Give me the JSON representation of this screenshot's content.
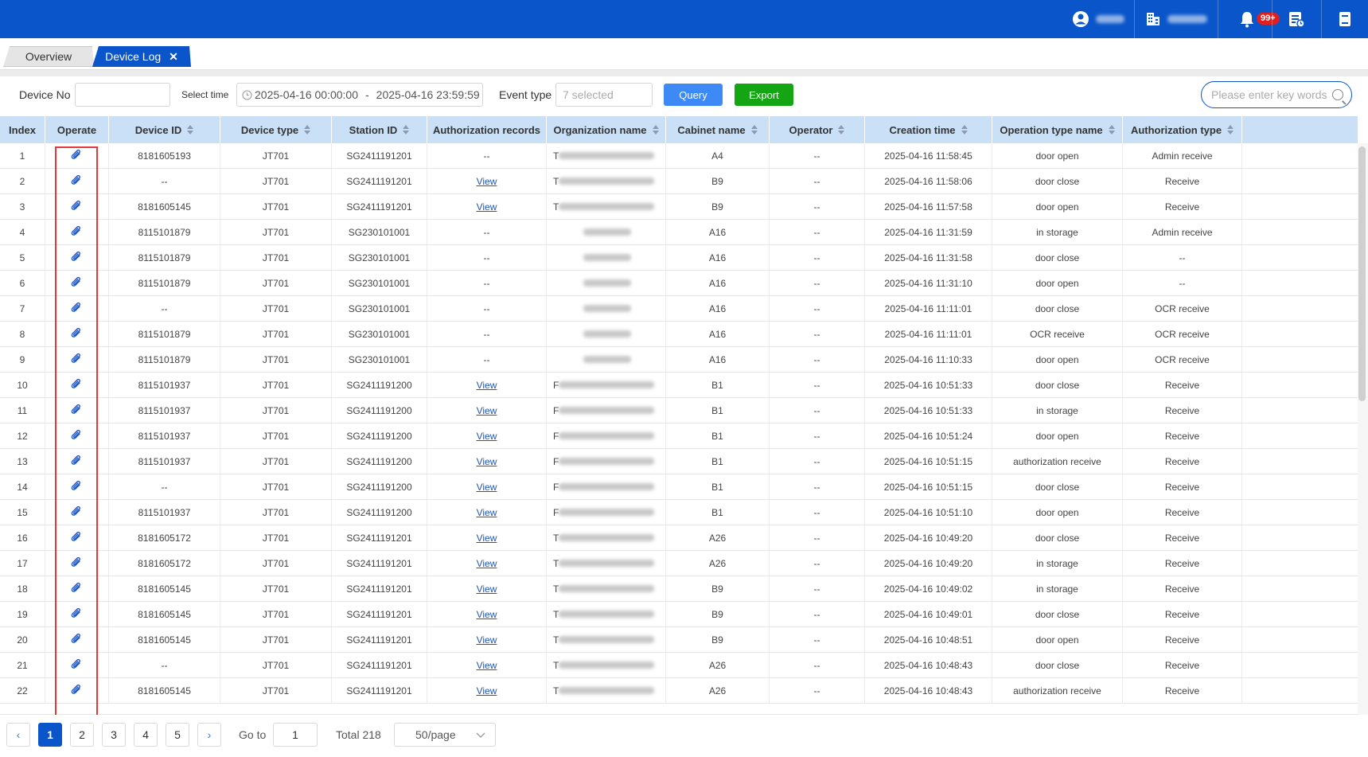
{
  "header": {
    "user_icon": "user-circle-icon",
    "org_icon": "building-icon",
    "notification_icon": "bell-icon",
    "notification_badge": "99+",
    "task_icon": "task-list-icon",
    "book_icon": "book-icon"
  },
  "tabs": [
    {
      "label": "Overview"
    },
    {
      "label": "Device Log",
      "close": "✕"
    }
  ],
  "filters": {
    "device_no_label": "Device No",
    "device_no_value": "",
    "select_time_label": "Select time",
    "time_start": "2025-04-16 00:00:00",
    "time_sep": "-",
    "time_end": "2025-04-16 23:59:59",
    "event_type_label": "Event type",
    "event_type_placeholder": "7 selected",
    "query_label": "Query",
    "export_label": "Export",
    "search_placeholder": "Please enter key words"
  },
  "colors": {
    "brand": "#0a55c9",
    "query": "#3d8af7",
    "export": "#13a513",
    "header_row": "#c9e0f6",
    "highlight": "#e23a3a"
  },
  "columns": [
    {
      "label": "Index",
      "sortable": false
    },
    {
      "label": "Operate",
      "sortable": false
    },
    {
      "label": "Device ID",
      "sortable": true
    },
    {
      "label": "Device type",
      "sortable": true
    },
    {
      "label": "Station ID",
      "sortable": true
    },
    {
      "label": "Authorization records",
      "sortable": false
    },
    {
      "label": "Organization name",
      "sortable": true
    },
    {
      "label": "Cabinet name",
      "sortable": true
    },
    {
      "label": "Operator",
      "sortable": true
    },
    {
      "label": "Creation time",
      "sortable": true
    },
    {
      "label": "Operation type name",
      "sortable": true
    },
    {
      "label": "Authorization type",
      "sortable": true
    }
  ],
  "rows": [
    {
      "index": "1",
      "device_id": "8181605193",
      "device_type": "JT701",
      "station_id": "SG2411191201",
      "auth": "--",
      "org": "T",
      "cabinet": "A4",
      "operator": "--",
      "time": "2025-04-16 11:58:45",
      "op_type": "door open",
      "auth_type": "Admin receive"
    },
    {
      "index": "2",
      "device_id": "--",
      "device_type": "JT701",
      "station_id": "SG2411191201",
      "auth": "View",
      "org": "T",
      "cabinet": "B9",
      "operator": "--",
      "time": "2025-04-16 11:58:06",
      "op_type": "door close",
      "auth_type": "Receive"
    },
    {
      "index": "3",
      "device_id": "8181605145",
      "device_type": "JT701",
      "station_id": "SG2411191201",
      "auth": "View",
      "org": "T",
      "cabinet": "B9",
      "operator": "--",
      "time": "2025-04-16 11:57:58",
      "op_type": "door open",
      "auth_type": "Receive"
    },
    {
      "index": "4",
      "device_id": "8115101879",
      "device_type": "JT701",
      "station_id": "SG230101001",
      "auth": "--",
      "org": "",
      "cabinet": "A16",
      "operator": "--",
      "time": "2025-04-16 11:31:59",
      "op_type": "in storage",
      "auth_type": "Admin receive"
    },
    {
      "index": "5",
      "device_id": "8115101879",
      "device_type": "JT701",
      "station_id": "SG230101001",
      "auth": "--",
      "org": "",
      "cabinet": "A16",
      "operator": "--",
      "time": "2025-04-16 11:31:58",
      "op_type": "door close",
      "auth_type": "--"
    },
    {
      "index": "6",
      "device_id": "8115101879",
      "device_type": "JT701",
      "station_id": "SG230101001",
      "auth": "--",
      "org": "",
      "cabinet": "A16",
      "operator": "--",
      "time": "2025-04-16 11:31:10",
      "op_type": "door open",
      "auth_type": "--"
    },
    {
      "index": "7",
      "device_id": "--",
      "device_type": "JT701",
      "station_id": "SG230101001",
      "auth": "--",
      "org": "",
      "cabinet": "A16",
      "operator": "--",
      "time": "2025-04-16 11:11:01",
      "op_type": "door close",
      "auth_type": "OCR receive"
    },
    {
      "index": "8",
      "device_id": "8115101879",
      "device_type": "JT701",
      "station_id": "SG230101001",
      "auth": "--",
      "org": "",
      "cabinet": "A16",
      "operator": "--",
      "time": "2025-04-16 11:11:01",
      "op_type": "OCR receive",
      "auth_type": "OCR receive"
    },
    {
      "index": "9",
      "device_id": "8115101879",
      "device_type": "JT701",
      "station_id": "SG230101001",
      "auth": "--",
      "org": "",
      "cabinet": "A16",
      "operator": "--",
      "time": "2025-04-16 11:10:33",
      "op_type": "door open",
      "auth_type": "OCR receive"
    },
    {
      "index": "10",
      "device_id": "8115101937",
      "device_type": "JT701",
      "station_id": "SG2411191200",
      "auth": "View",
      "org": "F",
      "cabinet": "B1",
      "operator": "--",
      "time": "2025-04-16 10:51:33",
      "op_type": "door close",
      "auth_type": "Receive"
    },
    {
      "index": "11",
      "device_id": "8115101937",
      "device_type": "JT701",
      "station_id": "SG2411191200",
      "auth": "View",
      "org": "F",
      "cabinet": "B1",
      "operator": "--",
      "time": "2025-04-16 10:51:33",
      "op_type": "in storage",
      "auth_type": "Receive"
    },
    {
      "index": "12",
      "device_id": "8115101937",
      "device_type": "JT701",
      "station_id": "SG2411191200",
      "auth": "View",
      "org": "F",
      "cabinet": "B1",
      "operator": "--",
      "time": "2025-04-16 10:51:24",
      "op_type": "door open",
      "auth_type": "Receive"
    },
    {
      "index": "13",
      "device_id": "8115101937",
      "device_type": "JT701",
      "station_id": "SG2411191200",
      "auth": "View",
      "org": "F",
      "cabinet": "B1",
      "operator": "--",
      "time": "2025-04-16 10:51:15",
      "op_type": "authorization receive",
      "auth_type": "Receive"
    },
    {
      "index": "14",
      "device_id": "--",
      "device_type": "JT701",
      "station_id": "SG2411191200",
      "auth": "View",
      "org": "F",
      "cabinet": "B1",
      "operator": "--",
      "time": "2025-04-16 10:51:15",
      "op_type": "door close",
      "auth_type": "Receive"
    },
    {
      "index": "15",
      "device_id": "8115101937",
      "device_type": "JT701",
      "station_id": "SG2411191200",
      "auth": "View",
      "org": "F",
      "cabinet": "B1",
      "operator": "--",
      "time": "2025-04-16 10:51:10",
      "op_type": "door open",
      "auth_type": "Receive"
    },
    {
      "index": "16",
      "device_id": "8181605172",
      "device_type": "JT701",
      "station_id": "SG2411191201",
      "auth": "View",
      "org": "T",
      "cabinet": "A26",
      "operator": "--",
      "time": "2025-04-16 10:49:20",
      "op_type": "door close",
      "auth_type": "Receive"
    },
    {
      "index": "17",
      "device_id": "8181605172",
      "device_type": "JT701",
      "station_id": "SG2411191201",
      "auth": "View",
      "org": "T",
      "cabinet": "A26",
      "operator": "--",
      "time": "2025-04-16 10:49:20",
      "op_type": "in storage",
      "auth_type": "Receive"
    },
    {
      "index": "18",
      "device_id": "8181605145",
      "device_type": "JT701",
      "station_id": "SG2411191201",
      "auth": "View",
      "org": "T",
      "cabinet": "B9",
      "operator": "--",
      "time": "2025-04-16 10:49:02",
      "op_type": "in storage",
      "auth_type": "Receive"
    },
    {
      "index": "19",
      "device_id": "8181605145",
      "device_type": "JT701",
      "station_id": "SG2411191201",
      "auth": "View",
      "org": "T",
      "cabinet": "B9",
      "operator": "--",
      "time": "2025-04-16 10:49:01",
      "op_type": "door close",
      "auth_type": "Receive"
    },
    {
      "index": "20",
      "device_id": "8181605145",
      "device_type": "JT701",
      "station_id": "SG2411191201",
      "auth": "View",
      "org": "T",
      "cabinet": "B9",
      "operator": "--",
      "time": "2025-04-16 10:48:51",
      "op_type": "door open",
      "auth_type": "Receive"
    },
    {
      "index": "21",
      "device_id": "--",
      "device_type": "JT701",
      "station_id": "SG2411191201",
      "auth": "View",
      "org": "T",
      "cabinet": "A26",
      "operator": "--",
      "time": "2025-04-16 10:48:43",
      "op_type": "door close",
      "auth_type": "Receive"
    },
    {
      "index": "22",
      "device_id": "8181605145",
      "device_type": "JT701",
      "station_id": "SG2411191201",
      "auth": "View",
      "org": "T",
      "cabinet": "A26",
      "operator": "--",
      "time": "2025-04-16 10:48:43",
      "op_type": "authorization receive",
      "auth_type": "Receive"
    }
  ],
  "pagination": {
    "prev": "‹",
    "next": "›",
    "pages": [
      "1",
      "2",
      "3",
      "4",
      "5"
    ],
    "active_page": "1",
    "goto_label": "Go to",
    "goto_value": "1",
    "total_label": "Total 218",
    "page_size": "50/page"
  }
}
